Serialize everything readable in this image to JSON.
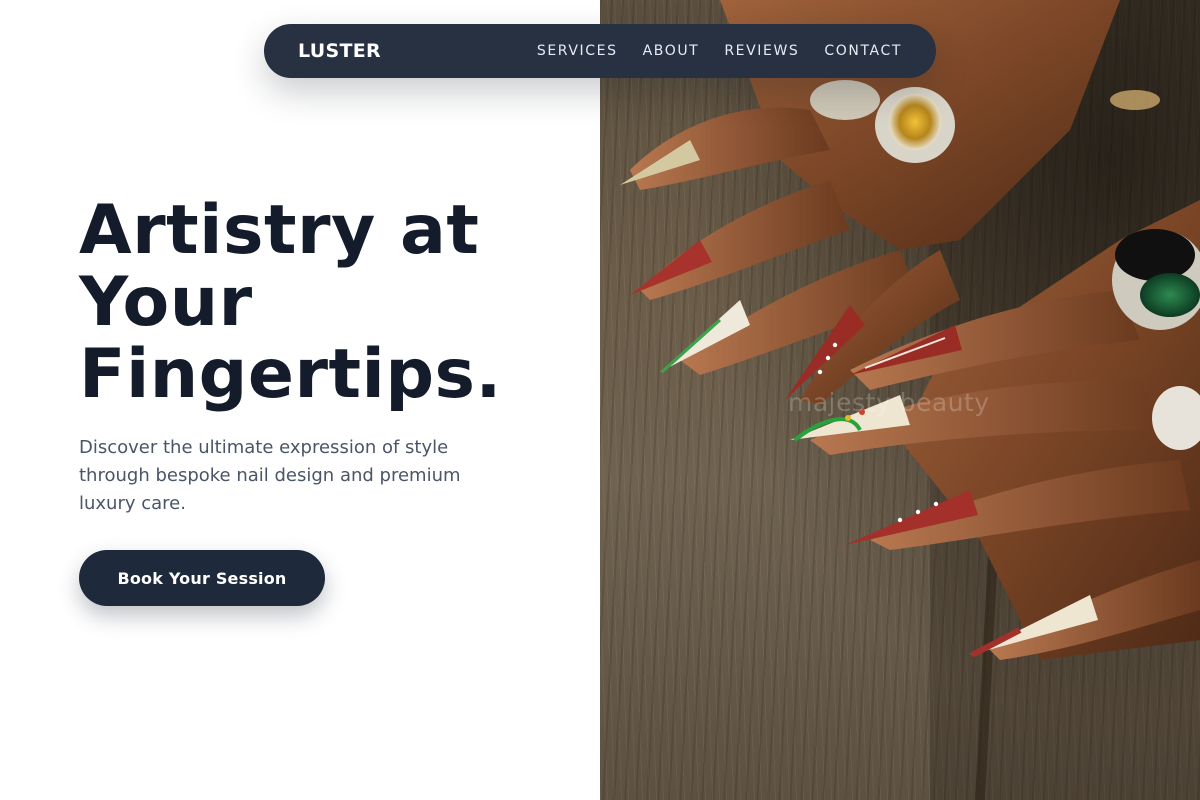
{
  "nav": {
    "brand": "LUSTER",
    "links": [
      "SERVICES",
      "ABOUT",
      "REVIEWS",
      "CONTACT"
    ]
  },
  "hero": {
    "headline_lines": [
      "Artistry at",
      "Your",
      "Fingertips."
    ],
    "subtext": "Discover the ultimate expression of style through bespoke nail design and premium luxury care.",
    "cta_label": "Book Your Session",
    "image_watermark": "majesty beauty"
  },
  "colors": {
    "nav_bg": "#273142",
    "headline": "#141c2c",
    "cta_bg": "#1e293b",
    "body_text": "#4a5567"
  }
}
